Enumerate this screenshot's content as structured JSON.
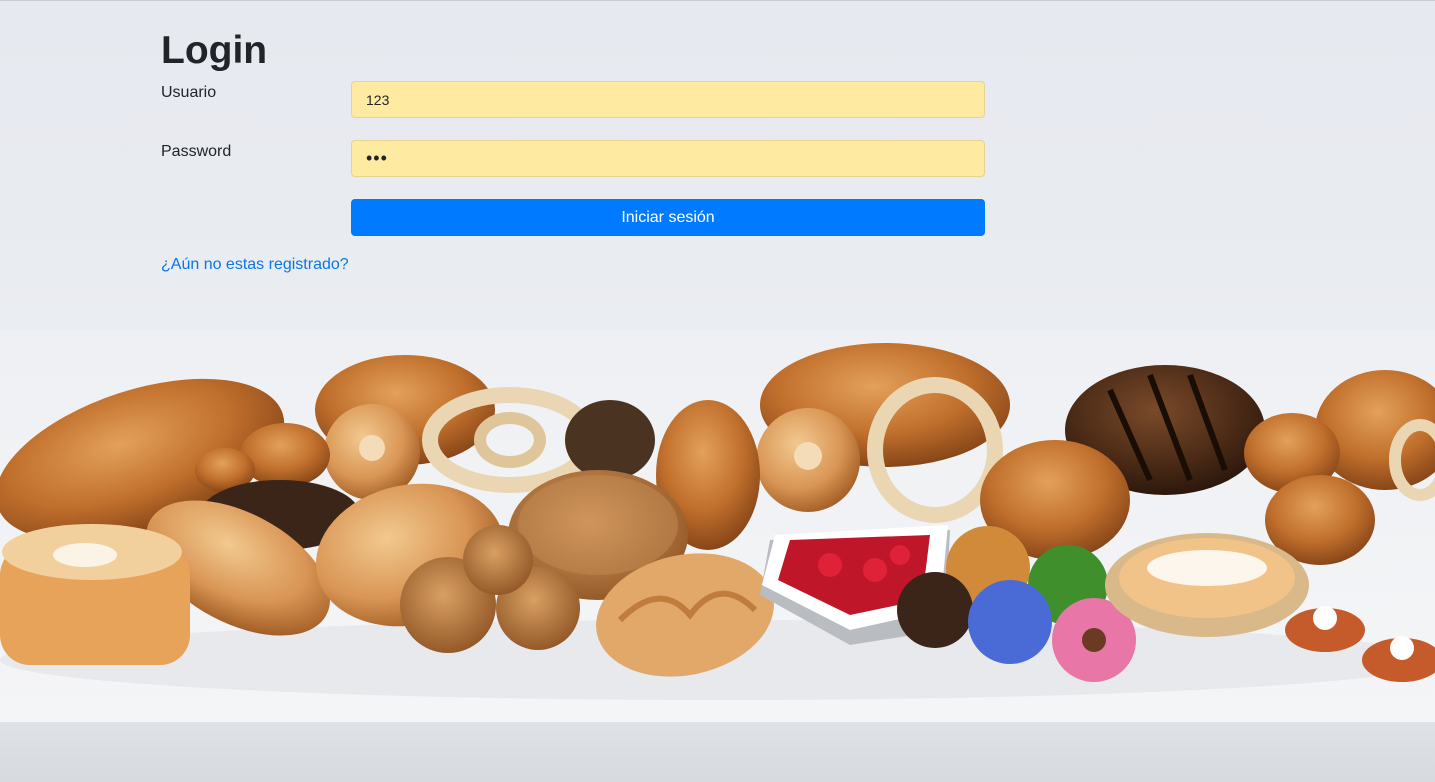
{
  "page": {
    "title": "Login"
  },
  "form": {
    "user_label": "Usuario",
    "user_value": "123",
    "password_label": "Password",
    "password_value": "123",
    "submit_label": "Iniciar sesión",
    "register_link": "¿Aún no estas registrado?"
  },
  "background": {
    "image": "bakery-bread-pastries-photo"
  },
  "colors": {
    "autofill": "#feeba1",
    "primary": "#007bff",
    "link": "#0b76e6",
    "text": "#212529"
  }
}
